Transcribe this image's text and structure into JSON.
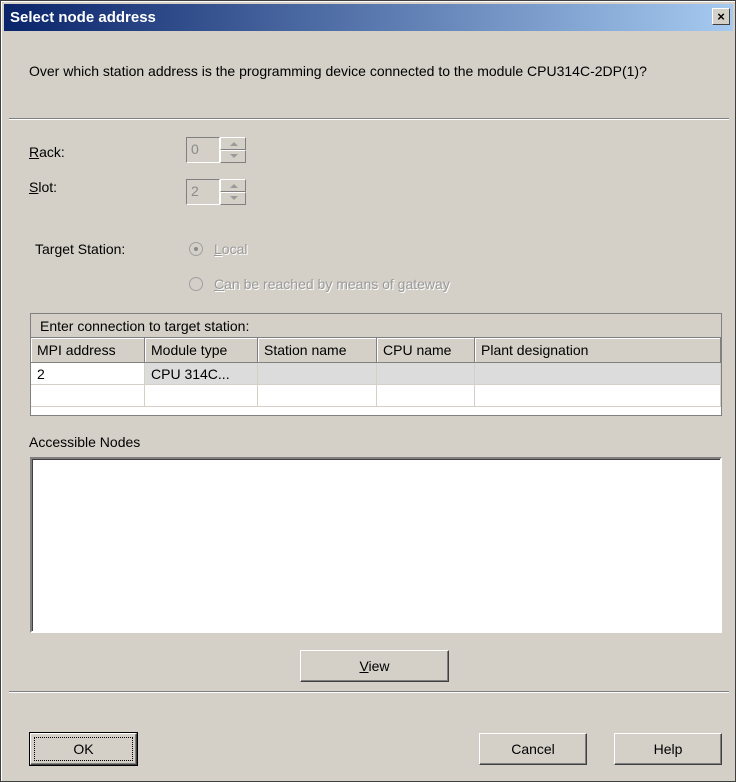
{
  "window": {
    "title": "Select node address",
    "close_label": "×"
  },
  "question": "Over which station address is the programming device connected to the module CPU314C-2DP(1)?",
  "rack": {
    "label_first": "R",
    "label_rest": "ack:",
    "value": "0"
  },
  "slot": {
    "label_first": "S",
    "label_rest": "lot:",
    "value": "2"
  },
  "target_station": {
    "label": "Target Station:",
    "options": [
      {
        "label_first": "L",
        "label_rest": "ocal",
        "selected": true
      },
      {
        "label_first": "C",
        "label_rest": "an be reached by means of gateway",
        "selected": false
      }
    ]
  },
  "connection_table": {
    "caption": "Enter connection to target station:",
    "headers": [
      "MPI address",
      "Module type",
      "Station name",
      "CPU name",
      "Plant designation"
    ],
    "rows": [
      [
        "2",
        "CPU 314C...",
        "",
        "",
        ""
      ],
      [
        "",
        "",
        "",
        "",
        ""
      ]
    ]
  },
  "accessible_nodes": {
    "label": "Accessible Nodes",
    "items": []
  },
  "buttons": {
    "view_first": "V",
    "view_rest": "iew",
    "ok": "OK",
    "cancel": "Cancel",
    "help": "Help"
  },
  "colors": {
    "title_gradient_start": "#0a246a",
    "title_gradient_end": "#a6caf0",
    "dialog_face": "#d4d0c8"
  }
}
